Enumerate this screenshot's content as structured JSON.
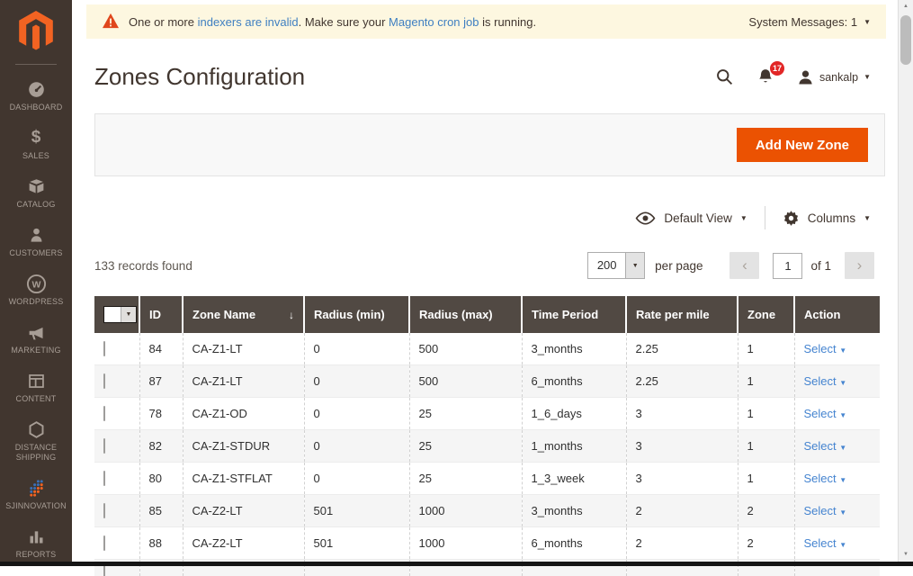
{
  "message_bar": {
    "prefix": "One or more ",
    "link_indexers": "indexers are invalid",
    "middle": ". Make sure your ",
    "link_cron": "Magento cron job",
    "suffix": " is running.",
    "system_messages": "System Messages: 1"
  },
  "sidebar": {
    "items": [
      {
        "label": "DASHBOARD",
        "icon": "dashboard-icon"
      },
      {
        "label": "SALES",
        "icon": "sales-icon"
      },
      {
        "label": "CATALOG",
        "icon": "catalog-icon"
      },
      {
        "label": "CUSTOMERS",
        "icon": "customers-icon"
      },
      {
        "label": "WORDPRESS",
        "icon": "wordpress-icon"
      },
      {
        "label": "MARKETING",
        "icon": "marketing-icon"
      },
      {
        "label": "CONTENT",
        "icon": "content-icon"
      },
      {
        "label": "DISTANCE SHIPPING",
        "icon": "distance-shipping-icon"
      },
      {
        "label": "SJINNOVATION",
        "icon": "sjinnovation-icon"
      },
      {
        "label": "REPORTS",
        "icon": "reports-icon"
      }
    ]
  },
  "header": {
    "title": "Zones Configuration",
    "notification_count": "17",
    "username": "sankalp"
  },
  "action_bar": {
    "add_button": "Add New Zone"
  },
  "view_controls": {
    "default_view": "Default View",
    "columns": "Columns"
  },
  "pagination": {
    "records_found": "133 records found",
    "per_page_value": "200",
    "per_page_label": "per page",
    "current_page": "1",
    "of_label": "of 1"
  },
  "table": {
    "columns": {
      "id": "ID",
      "zone_name": "Zone Name",
      "radius_min": "Radius (min)",
      "radius_max": "Radius (max)",
      "time_period": "Time Period",
      "rate": "Rate per mile",
      "zone": "Zone",
      "action": "Action"
    },
    "action_label": "Select",
    "rows": [
      {
        "id": "84",
        "zone_name": "CA-Z1-LT",
        "radius_min": "0",
        "radius_max": "500",
        "time_period": "3_months",
        "rate": "2.25",
        "zone": "1"
      },
      {
        "id": "87",
        "zone_name": "CA-Z1-LT",
        "radius_min": "0",
        "radius_max": "500",
        "time_period": "6_months",
        "rate": "2.25",
        "zone": "1"
      },
      {
        "id": "78",
        "zone_name": "CA-Z1-OD",
        "radius_min": "0",
        "radius_max": "25",
        "time_period": "1_6_days",
        "rate": "3",
        "zone": "1"
      },
      {
        "id": "82",
        "zone_name": "CA-Z1-STDUR",
        "radius_min": "0",
        "radius_max": "25",
        "time_period": "1_months",
        "rate": "3",
        "zone": "1"
      },
      {
        "id": "80",
        "zone_name": "CA-Z1-STFLAT",
        "radius_min": "0",
        "radius_max": "25",
        "time_period": "1_3_week",
        "rate": "3",
        "zone": "1"
      },
      {
        "id": "85",
        "zone_name": "CA-Z2-LT",
        "radius_min": "501",
        "radius_max": "1000",
        "time_period": "3_months",
        "rate": "2",
        "zone": "2"
      },
      {
        "id": "88",
        "zone_name": "CA-Z2-LT",
        "radius_min": "501",
        "radius_max": "1000",
        "time_period": "6_months",
        "rate": "2",
        "zone": "2"
      }
    ]
  },
  "colors": {
    "brand_orange": "#eb5202",
    "sidebar_bg": "#41362f",
    "grid_header_bg": "#514943",
    "link_blue": "#4584d0",
    "badge_red": "#e22626",
    "message_bg": "#fdf7e0"
  }
}
